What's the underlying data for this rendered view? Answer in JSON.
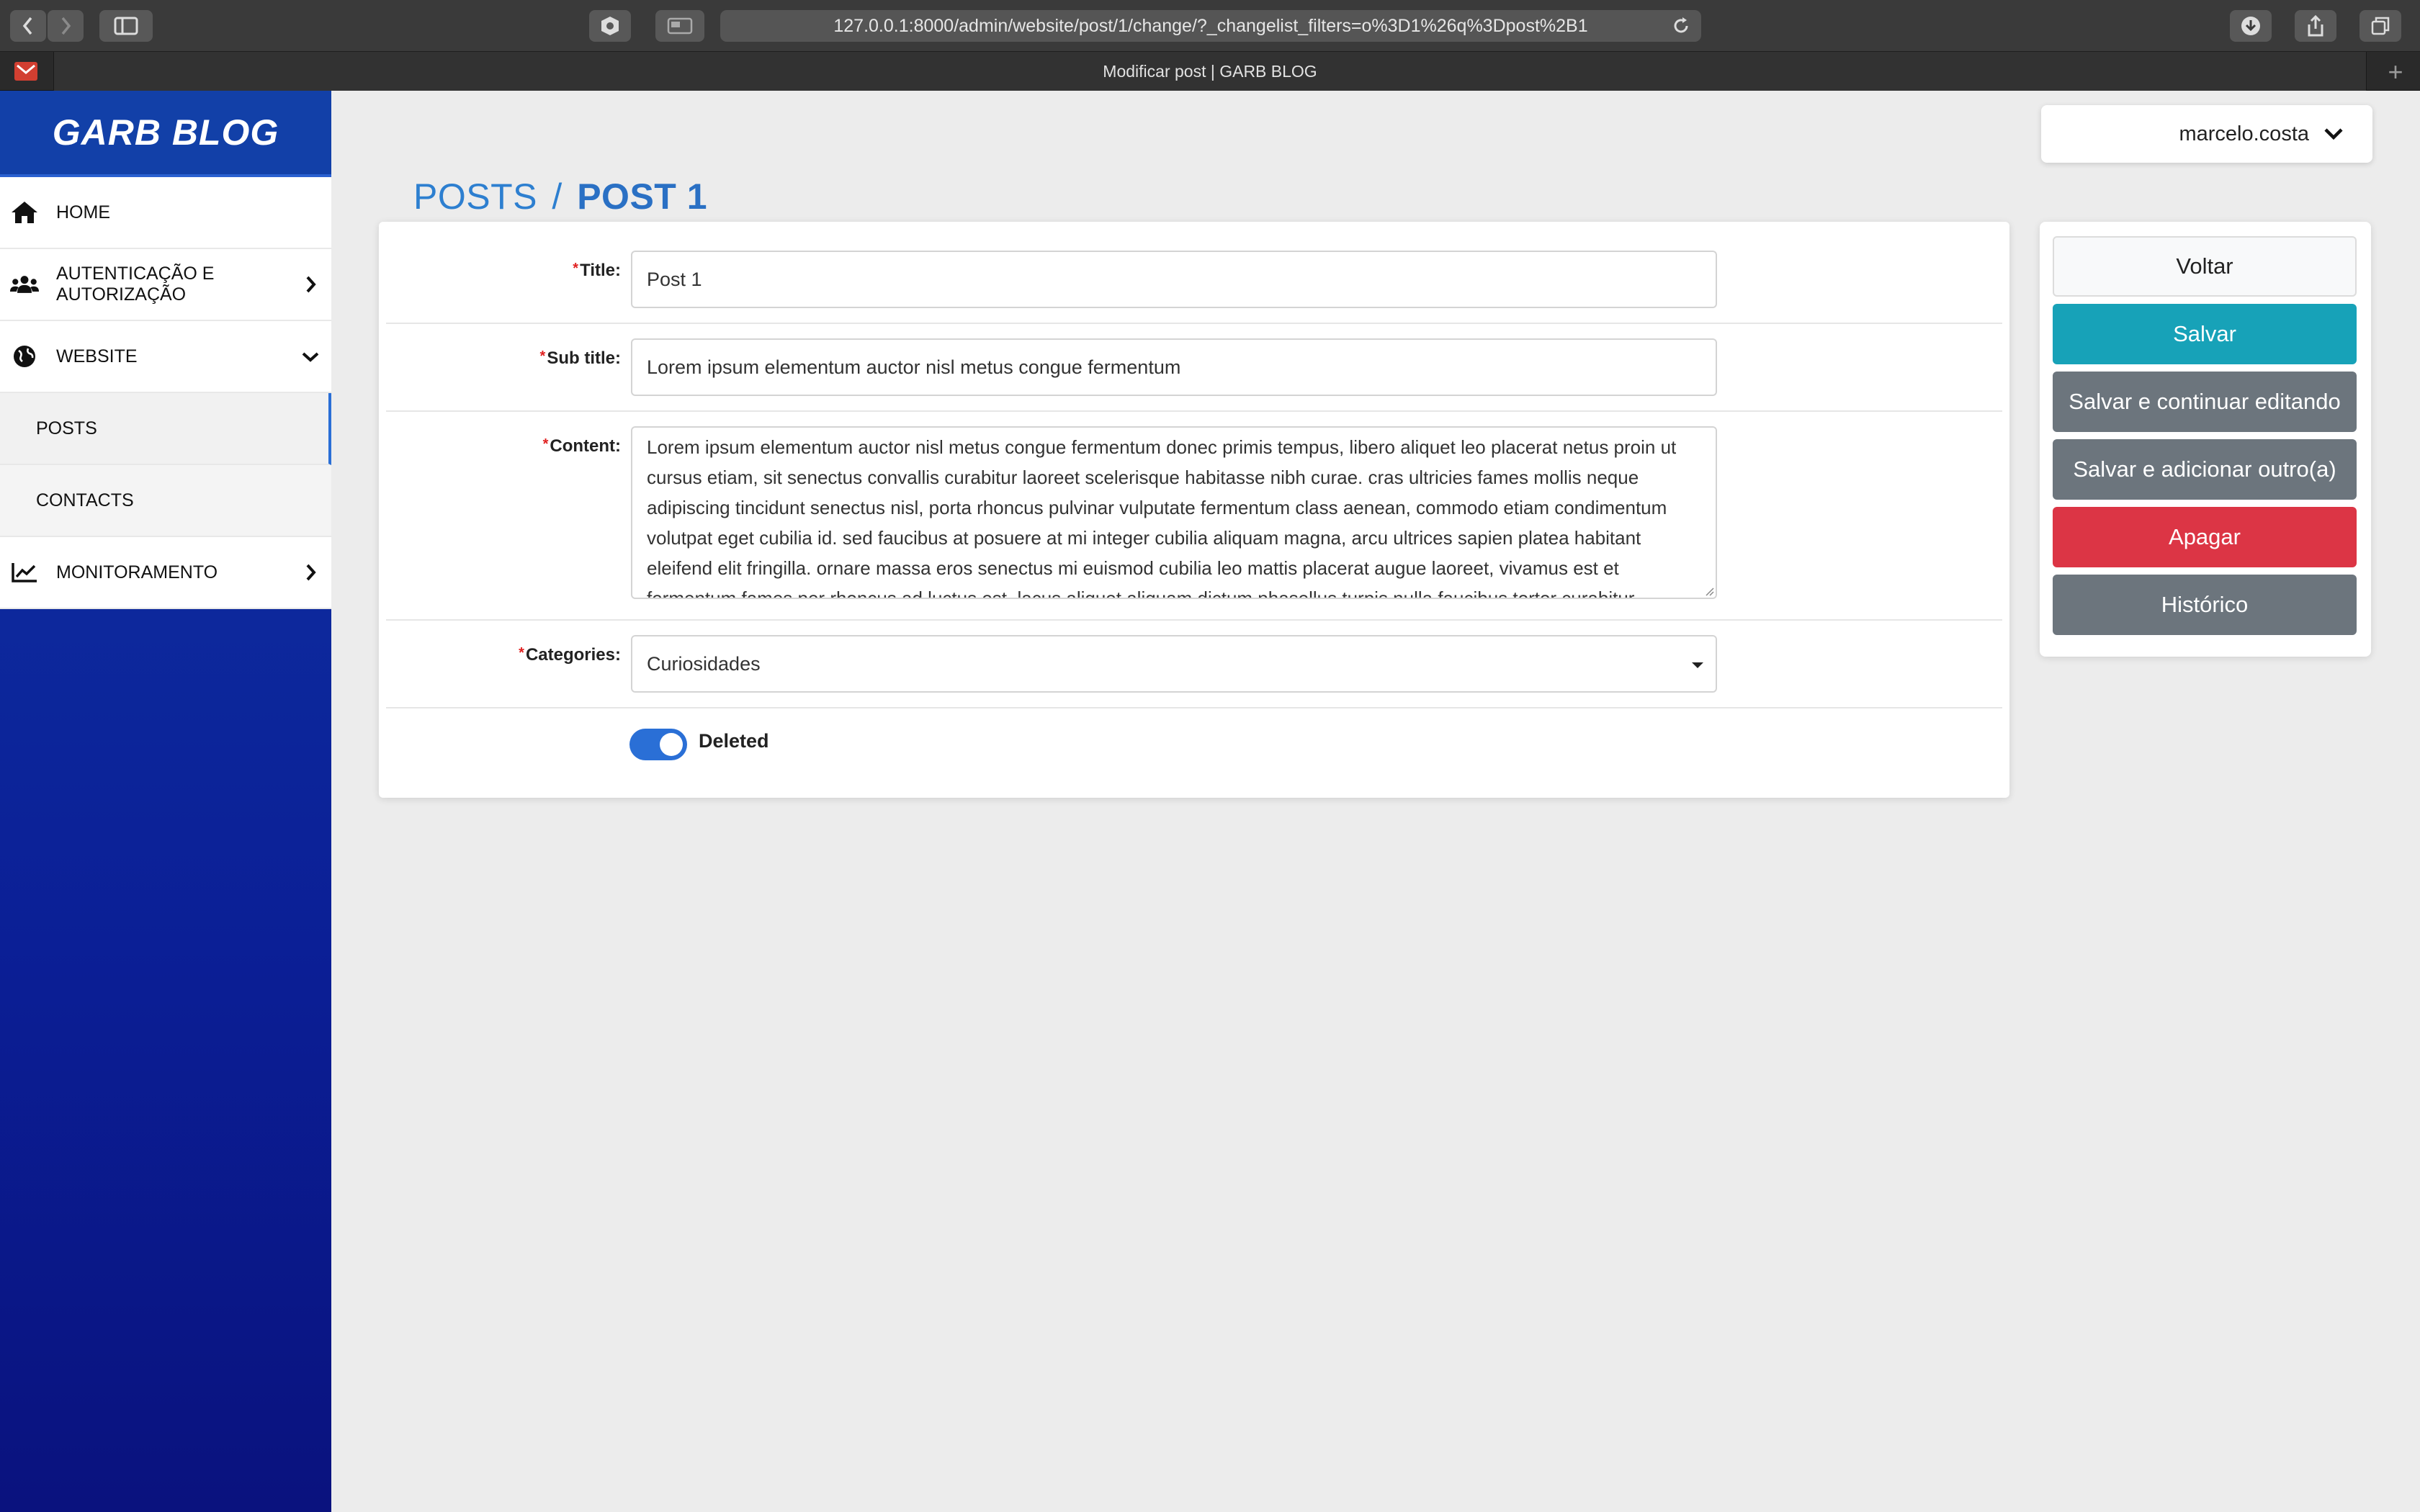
{
  "browser": {
    "url": "127.0.0.1:8000/admin/website/post/1/change/?_changelist_filters=o%3D1%26q%3Dpost%2B1",
    "tab_title": "Modificar post | GARB BLOG",
    "new_tab_symbol": "+"
  },
  "sidebar": {
    "brand": "GARB BLOG",
    "items": [
      {
        "label": "HOME",
        "icon": "home-icon"
      },
      {
        "label": "AUTENTICAÇÃO E AUTORIZAÇÃO",
        "icon": "users-icon"
      },
      {
        "label": "WEBSITE",
        "icon": "globe-icon"
      },
      {
        "label": "POSTS"
      },
      {
        "label": "CONTACTS"
      },
      {
        "label": "MONITORAMENTO",
        "icon": "chart-line-icon"
      }
    ]
  },
  "breadcrumb": {
    "parent": "POSTS",
    "separator": "/",
    "current": "POST 1"
  },
  "user": {
    "name": "marcelo.costa"
  },
  "form": {
    "title_label": "Title:",
    "title_value": "Post 1",
    "subtitle_label": "Sub title:",
    "subtitle_value": "Lorem ipsum elementum auctor nisl metus congue fermentum",
    "content_label": "Content:",
    "content_value": "Lorem ipsum elementum auctor nisl metus congue fermentum donec primis tempus, libero aliquet leo placerat netus proin ut cursus etiam, sit senectus convallis curabitur laoreet scelerisque habitasse nibh curae. cras ultricies fames mollis neque adipiscing tincidunt senectus nisl, porta rhoncus pulvinar vulputate fermentum class aenean, commodo etiam condimentum volutpat eget cubilia id. sed faucibus at posuere at mi integer cubilia aliquam magna, arcu ultrices sapien platea habitant eleifend elit fringilla. ornare massa eros senectus mi euismod cubilia leo mattis placerat augue laoreet, vivamus est et fermentum fames per rhoncus ad luctus est. lacus aliquet aliquam dictum phasellus turpis nulla faucibus tortor curabitur.",
    "categories_label": "Categories:",
    "categories_value": "Curiosidades",
    "deleted_label": "Deleted",
    "deleted_on": true,
    "required_mark": "*"
  },
  "actions": {
    "back": "Voltar",
    "save": "Salvar",
    "save_continue": "Salvar e continuar editando",
    "save_add": "Salvar e adicionar outro(a)",
    "delete": "Apagar",
    "history": "Histórico"
  },
  "colors": {
    "primary": "#2a6fd6",
    "save": "#17a2b8",
    "secondary": "#6c757d",
    "danger": "#dc3545",
    "sidebar": "#0b1f96"
  }
}
